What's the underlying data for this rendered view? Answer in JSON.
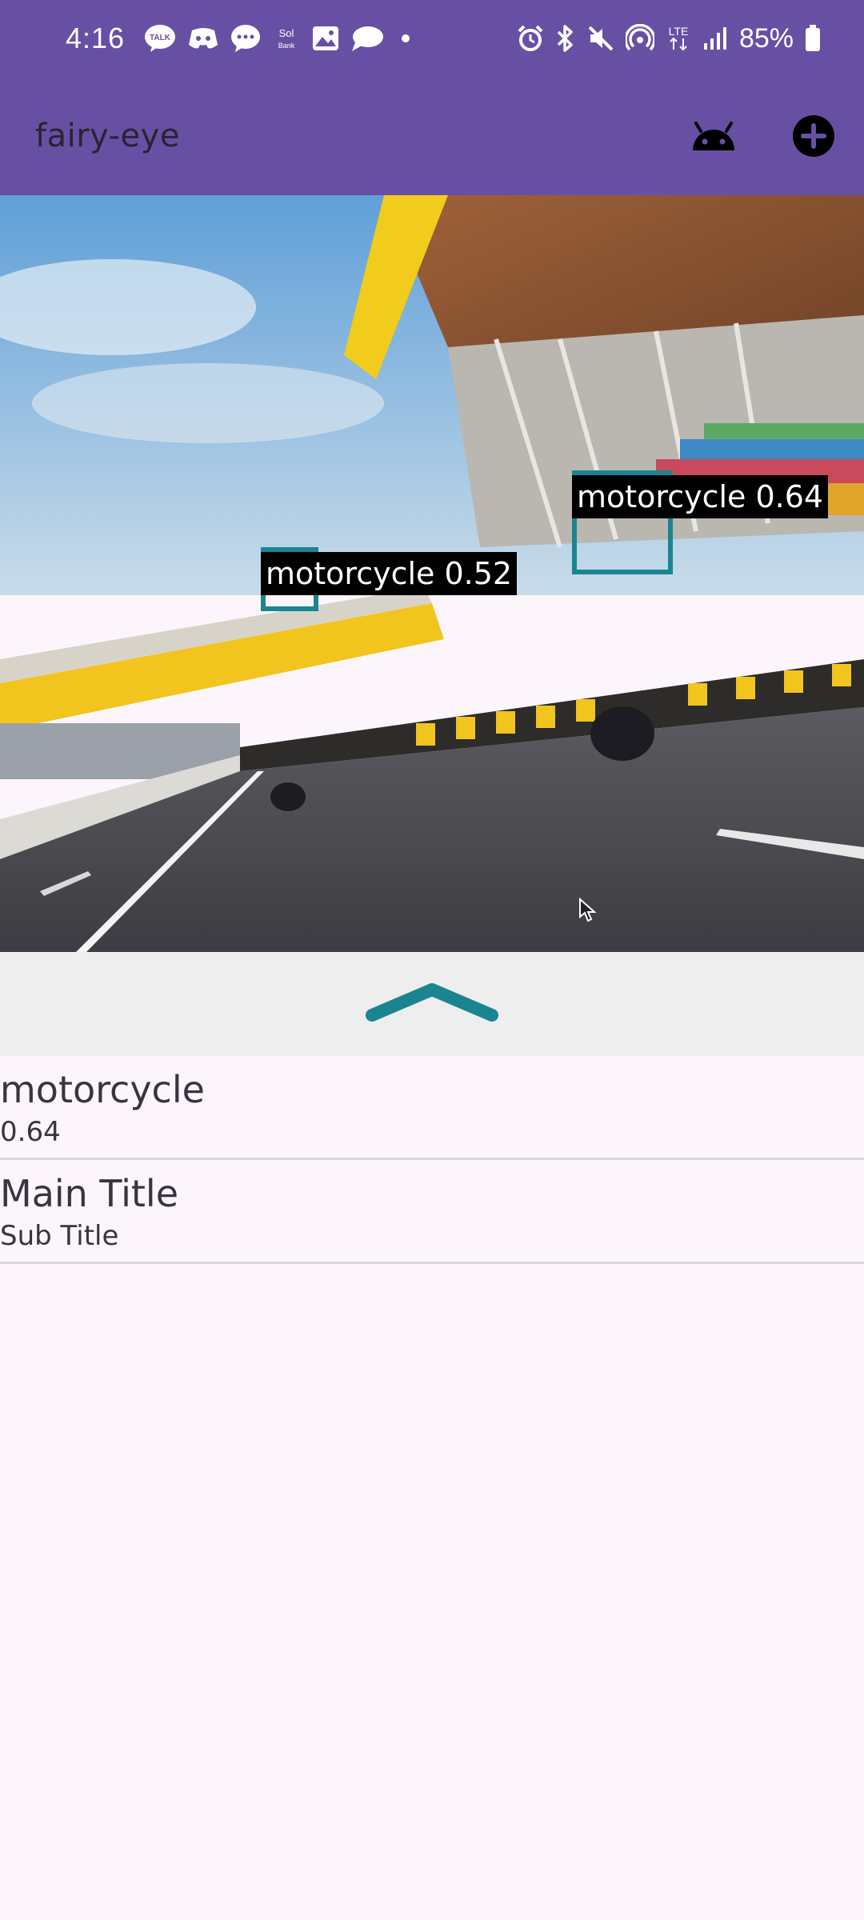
{
  "status_bar": {
    "time": "4:16",
    "battery": "85%",
    "notification_icons": [
      "talk-icon",
      "discord-icon",
      "message-icon",
      "sol-bank-icon",
      "gallery-icon",
      "chat-icon"
    ],
    "system_icons": [
      "alarm-icon",
      "bluetooth-icon",
      "mute-icon",
      "hotspot-icon",
      "lte-icon",
      "signal-icon",
      "battery-icon"
    ]
  },
  "app_bar": {
    "title": "fairy-eye",
    "actions": [
      "android-icon",
      "add-circle-icon"
    ]
  },
  "camera": {
    "detections": [
      {
        "label": "motorcycle 0.64"
      },
      {
        "label": "motorcycle 0.52"
      }
    ],
    "box_color": "#1a8590"
  },
  "results": [
    {
      "title": "motorcycle",
      "subtitle": "0.64"
    },
    {
      "title": "Main Title",
      "subtitle": "Sub Title"
    }
  ],
  "colors": {
    "primary": "#6750a4",
    "background": "#fcf6fc",
    "handle_bg": "#eeeeee",
    "accent": "#1a8590"
  }
}
